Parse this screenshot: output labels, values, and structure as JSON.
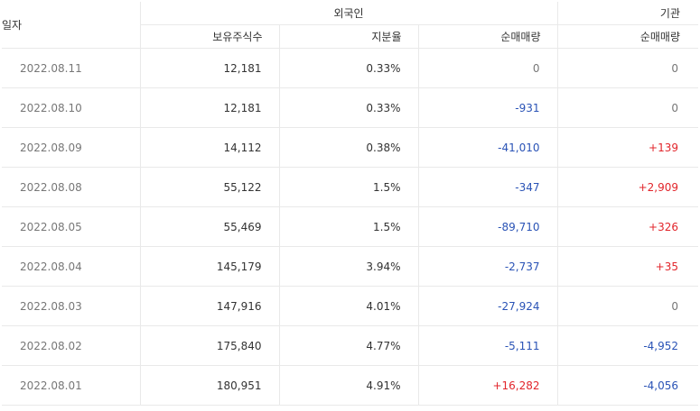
{
  "headers": {
    "date": "일자",
    "foreign": "외국인",
    "institution": "기관",
    "holdings": "보유주식수",
    "ownership": "지분율",
    "foreign_net": "순매매량",
    "inst_net": "순매매량"
  },
  "rows": [
    {
      "date": "2022.08.11",
      "holdings": "12,181",
      "ownership": "0.33%",
      "foreign_net": "0",
      "inst_net": "0"
    },
    {
      "date": "2022.08.10",
      "holdings": "12,181",
      "ownership": "0.33%",
      "foreign_net": "-931",
      "inst_net": "0"
    },
    {
      "date": "2022.08.09",
      "holdings": "14,112",
      "ownership": "0.38%",
      "foreign_net": "-41,010",
      "inst_net": "+139"
    },
    {
      "date": "2022.08.08",
      "holdings": "55,122",
      "ownership": "1.5%",
      "foreign_net": "-347",
      "inst_net": "+2,909"
    },
    {
      "date": "2022.08.05",
      "holdings": "55,469",
      "ownership": "1.5%",
      "foreign_net": "-89,710",
      "inst_net": "+326"
    },
    {
      "date": "2022.08.04",
      "holdings": "145,179",
      "ownership": "3.94%",
      "foreign_net": "-2,737",
      "inst_net": "+35"
    },
    {
      "date": "2022.08.03",
      "holdings": "147,916",
      "ownership": "4.01%",
      "foreign_net": "-27,924",
      "inst_net": "0"
    },
    {
      "date": "2022.08.02",
      "holdings": "175,840",
      "ownership": "4.77%",
      "foreign_net": "-5,111",
      "inst_net": "-4,952"
    },
    {
      "date": "2022.08.01",
      "holdings": "180,951",
      "ownership": "4.91%",
      "foreign_net": "+16,282",
      "inst_net": "-4,056"
    }
  ],
  "colors": {
    "positive": "#e2252b",
    "negative": "#2a53b6",
    "neutral": "#777777"
  }
}
